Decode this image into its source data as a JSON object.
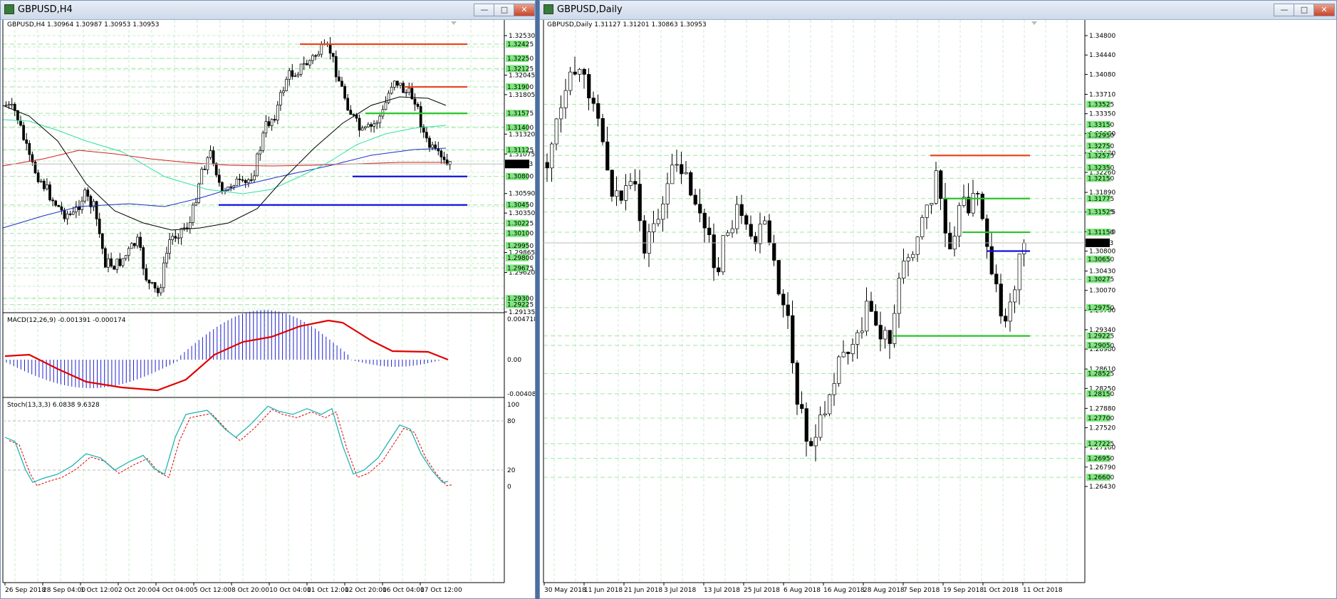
{
  "left_window": {
    "title": "GBPUSD,H4",
    "info": "GBPUSD,H4  1.30964 1.30987 1.30953 1.30953",
    "price_ticks": [
      "1.32530",
      "1.32045",
      "1.31805",
      "1.31320",
      "1.31075",
      "1.30590",
      "1.30350",
      "1.29865",
      "1.29620",
      "1.29135"
    ],
    "level_tags": [
      "1.32425",
      "1.32250",
      "1.32125",
      "1.31900",
      "1.31575",
      "1.31400",
      "1.31125",
      "1.30800",
      "1.30450",
      "1.30225",
      "1.30100",
      "1.29950",
      "1.29800",
      "1.29675",
      "1.29300",
      "1.29225"
    ],
    "current_price": "1.30953",
    "time_labels": [
      "26 Sep 2018",
      "28 Sep 04:00",
      "1 Oct 12:00",
      "2 Oct 20:00",
      "4 Oct 04:00",
      "5 Oct 12:00",
      "8 Oct 20:00",
      "10 Oct 04:00",
      "11 Oct 12:00",
      "12 Oct 20:00",
      "16 Oct 04:00",
      "17 Oct 12:00"
    ],
    "macd": {
      "label": "MACD(12,26,9) -0.001391 -0.000174",
      "ticks": [
        "0.004718",
        "0.00",
        "-0.004088"
      ]
    },
    "stoch": {
      "label": "Stoch(13,3,3) 6.0838 9.6328",
      "ticks": [
        "100",
        "80",
        "20",
        "0"
      ]
    }
  },
  "right_window": {
    "title": "GBPUSD,Daily",
    "info": "GBPUSD,Daily  1.31127 1.31201 1.30863 1.30953",
    "price_ticks": [
      "1.34800",
      "1.34440",
      "1.34080",
      "1.33710",
      "1.33350",
      "1.32980",
      "1.32620",
      "1.32260",
      "1.31890",
      "1.31525",
      "1.31160",
      "1.30800",
      "1.30430",
      "1.30070",
      "1.29700",
      "1.29340",
      "1.28980",
      "1.28610",
      "1.28250",
      "1.27880",
      "1.27520",
      "1.27160",
      "1.26790",
      "1.26430"
    ],
    "level_tags": [
      "1.33525",
      "1.33150",
      "1.32950",
      "1.32750",
      "1.32575",
      "1.32350",
      "1.32150",
      "1.31775",
      "1.31525",
      "1.31150",
      "1.30650",
      "1.30275",
      "1.29750",
      "1.29225",
      "1.29050",
      "1.28525",
      "1.28150",
      "1.27700",
      "1.27225",
      "1.26950",
      "1.26600"
    ],
    "current_price": "1.30953",
    "time_labels": [
      "30 May 2018",
      "11 Jun 2018",
      "21 Jun 2018",
      "3 Jul 2018",
      "13 Jul 2018",
      "25 Jul 2018",
      "6 Aug 2018",
      "16 Aug 2018",
      "28 Aug 2018",
      "7 Sep 2018",
      "19 Sep 2018",
      "1 Oct 2018",
      "11 Oct 2018"
    ]
  },
  "window_buttons": {
    "minimize": "—",
    "maximize": "□",
    "close": "✕"
  },
  "colors": {
    "level_red": "#e8471f",
    "level_green": "#29c429",
    "level_blue": "#1010e0",
    "ma_red": "#d42020",
    "ma_blue": "#2030c8",
    "ma_cyan": "#30e0a0",
    "ma_black": "#000000",
    "macd_hist": "#2020d0",
    "signal": "#e00000",
    "stoch_main": "#10b0b0",
    "stoch_signal": "#e00000",
    "tag_green": "#7fe87f"
  }
}
